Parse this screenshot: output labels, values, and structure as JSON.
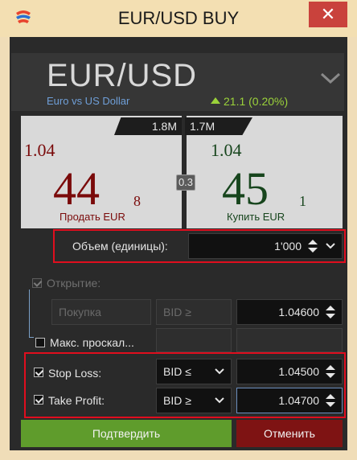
{
  "window": {
    "title": "EUR/USD BUY",
    "close_label": "✕"
  },
  "symbol": {
    "name": "EUR/USD",
    "description": "Euro vs US Dollar",
    "change": "21.1 (0.20%)"
  },
  "sell": {
    "liquidity": "1.8M",
    "price_prefix": "1.04",
    "price_big": "44",
    "price_pip": "8",
    "label": "Продать EUR"
  },
  "buy": {
    "liquidity": "1.7M",
    "price_prefix": "1.04",
    "price_big": "45",
    "price_pip": "1",
    "label": "Купить EUR"
  },
  "spread": "0.3",
  "volume": {
    "label": "Объем (единицы):",
    "value": "1'000"
  },
  "opening": {
    "label": "Открытие:",
    "side": "Покупка",
    "condition": "BID ≥",
    "price": "1.04600"
  },
  "slippage": {
    "label": "Макс. проскал..."
  },
  "stop_loss": {
    "label": "Stop Loss:",
    "condition": "BID ≤",
    "price": "1.04500"
  },
  "take_profit": {
    "label": "Take Profit:",
    "condition": "BID ≥",
    "price": "1.04700"
  },
  "actions": {
    "confirm": "Подтвердить",
    "cancel": "Отменить"
  },
  "colors": {
    "sell_price": "#7a0a0a",
    "buy_price": "#17451d",
    "change": "#9bd23a",
    "highlight": "#e00e1e",
    "confirm": "#5f9c2c",
    "cancel": "#7e1313"
  },
  "icons": {
    "app": "logo-icon",
    "change": "arrow-up-icon",
    "expand": "chevron-down-icon",
    "spinner": "up-down-spinner-icon"
  }
}
